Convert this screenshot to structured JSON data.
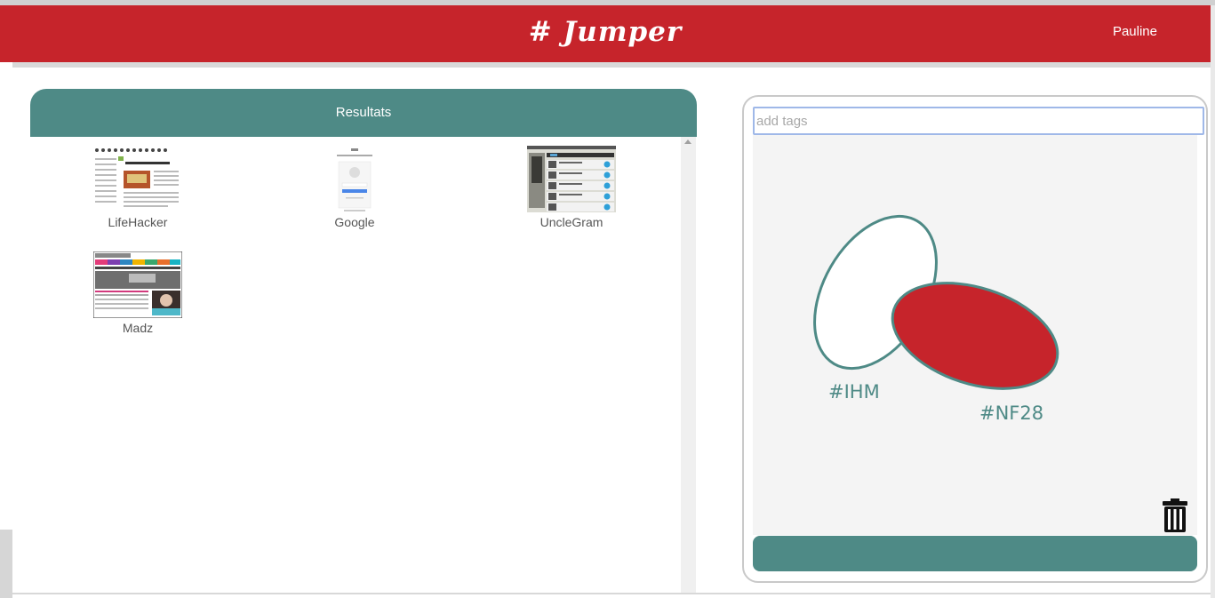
{
  "header": {
    "logo": "# Jumper",
    "user": "Pauline"
  },
  "results": {
    "title": "Resultats",
    "items": [
      {
        "label": "LifeHacker",
        "thumb": "lifehacker"
      },
      {
        "label": "Google",
        "thumb": "google"
      },
      {
        "label": "UncleGram",
        "thumb": "unclegram"
      },
      {
        "label": "Madz",
        "thumb": "madz"
      }
    ]
  },
  "tags": {
    "placeholder": "add tags",
    "circles": [
      {
        "label": "#IHM",
        "fill": "#ffffff"
      },
      {
        "label": "#NF28",
        "fill": "#c6242b"
      }
    ],
    "trash_icon": "trash-icon"
  },
  "colors": {
    "brand_red": "#c6242b",
    "teal": "#4e8a86"
  }
}
